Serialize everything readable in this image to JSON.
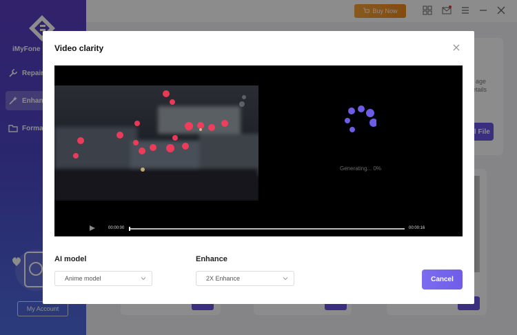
{
  "app": {
    "name": "iMyFone U",
    "buy_label": "Buy Now",
    "account_label": "My Account"
  },
  "sidebar": {
    "items": [
      {
        "label": "Repair",
        "icon": "wrench-icon"
      },
      {
        "label": "Enhanc",
        "icon": "magic-wand-icon"
      },
      {
        "label": "Forma",
        "icon": "folder-icon"
      }
    ]
  },
  "background": {
    "text_line1": "age",
    "text_line2": "etails",
    "file_button": "l File"
  },
  "dialog": {
    "title": "Video clarity",
    "generating_text": "Generating... 0%",
    "time_start": "00:00:00",
    "time_end": "00:00:16",
    "progress": 0,
    "ai_model": {
      "label": "AI model",
      "value": "Anime model"
    },
    "enhance": {
      "label": "Enhance",
      "value": "2X Enhance"
    },
    "cancel_label": "Cancel"
  },
  "colors": {
    "accent": "#6f5de8",
    "buy": "#f08a1c",
    "sidebar_top": "#5b3ec4",
    "sidebar_bottom": "#4f6de0"
  }
}
